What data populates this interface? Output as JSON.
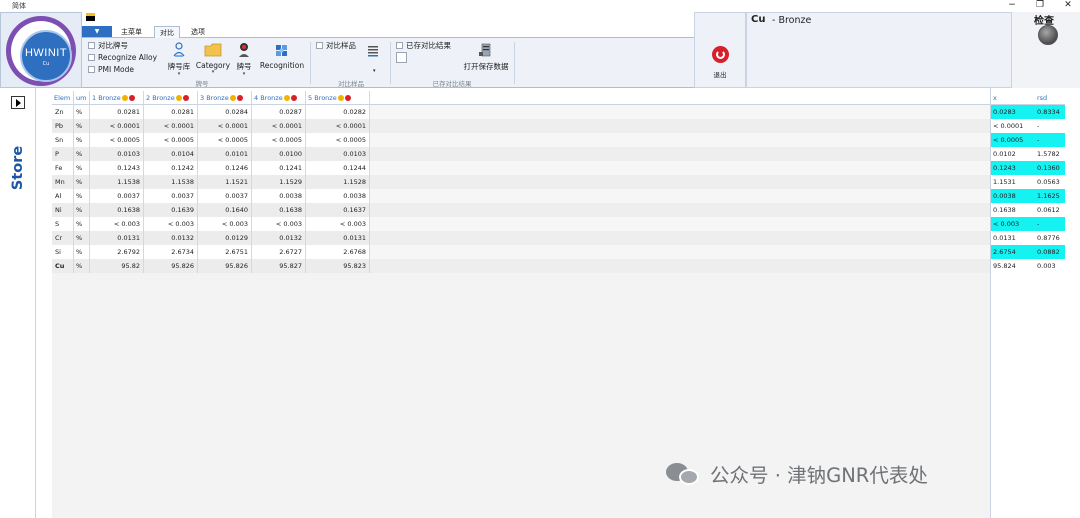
{
  "window": {
    "title": "简体",
    "min_glyph": "−",
    "restore_glyph": "❐",
    "close_glyph": "✕"
  },
  "logo": {
    "text": "HWINIT",
    "sub": "Cu"
  },
  "ribbon": {
    "tabs": [
      {
        "label": "主菜单",
        "active": false
      },
      {
        "label": "对比",
        "active": true
      },
      {
        "label": "选项",
        "active": false
      }
    ],
    "groups": {
      "grade": {
        "label": "牌号",
        "checks": [
          "对比牌号",
          "Recognize Alloy",
          "PMI Mode"
        ],
        "buttons": [
          "牌号库",
          "Category",
          "牌号",
          "Recognition"
        ]
      },
      "sample": {
        "label": "对比样品",
        "checks": [
          "对比样品"
        ]
      },
      "saved": {
        "label": "已存对比结果",
        "checks": [
          "已存对比结果"
        ],
        "open_button": "打开保存数据"
      }
    }
  },
  "exit": {
    "label": "退出"
  },
  "result": {
    "element": "Cu",
    "grade": "- Bronze"
  },
  "check": {
    "label": "检查"
  },
  "side": {
    "title": "Store Analysis"
  },
  "table": {
    "columns": [
      "Elem",
      "um",
      "1 Bronze",
      "2 Bronze",
      "3 Bronze",
      "4 Bronze",
      "5 Bronze"
    ],
    "rows": [
      {
        "el": "Zn",
        "um": "%",
        "v": [
          "0.0281",
          "0.0281",
          "0.0284",
          "0.0287",
          "0.0282"
        ]
      },
      {
        "el": "Pb",
        "um": "%",
        "v": [
          "< 0.0001",
          "< 0.0001",
          "< 0.0001",
          "< 0.0001",
          "< 0.0001"
        ]
      },
      {
        "el": "Sn",
        "um": "%",
        "v": [
          "< 0.0005",
          "< 0.0005",
          "< 0.0005",
          "< 0.0005",
          "< 0.0005"
        ]
      },
      {
        "el": "P",
        "um": "%",
        "v": [
          "0.0103",
          "0.0104",
          "0.0101",
          "0.0100",
          "0.0103"
        ]
      },
      {
        "el": "Fe",
        "um": "%",
        "v": [
          "0.1243",
          "0.1242",
          "0.1246",
          "0.1241",
          "0.1244"
        ]
      },
      {
        "el": "Mn",
        "um": "%",
        "v": [
          "1.1538",
          "1.1538",
          "1.1521",
          "1.1529",
          "1.1528"
        ]
      },
      {
        "el": "Al",
        "um": "%",
        "v": [
          "0.0037",
          "0.0037",
          "0.0037",
          "0.0038",
          "0.0038"
        ]
      },
      {
        "el": "Ni",
        "um": "%",
        "v": [
          "0.1638",
          "0.1639",
          "0.1640",
          "0.1638",
          "0.1637"
        ]
      },
      {
        "el": "S",
        "um": "%",
        "v": [
          "< 0.003",
          "< 0.003",
          "< 0.003",
          "< 0.003",
          "< 0.003"
        ]
      },
      {
        "el": "Cr",
        "um": "%",
        "v": [
          "0.0131",
          "0.0132",
          "0.0129",
          "0.0132",
          "0.0131"
        ]
      },
      {
        "el": "Si",
        "um": "%",
        "v": [
          "2.6792",
          "2.6734",
          "2.6751",
          "2.6727",
          "2.6768"
        ]
      },
      {
        "el": "Cu",
        "um": "%",
        "v": [
          "95.82",
          "95.826",
          "95.826",
          "95.827",
          "95.823"
        ]
      }
    ]
  },
  "stats": {
    "columns": [
      "x",
      "rsd"
    ],
    "rows": [
      {
        "x": "0.0283",
        "rsd": "0.8334",
        "hl": true
      },
      {
        "x": "< 0.0001",
        "rsd": "-",
        "hl": false
      },
      {
        "x": "< 0.0005",
        "rsd": "-",
        "hl": true
      },
      {
        "x": "0.0102",
        "rsd": "1.5782",
        "hl": false
      },
      {
        "x": "0.1243",
        "rsd": "0.1360",
        "hl": true
      },
      {
        "x": "1.1531",
        "rsd": "0.0563",
        "hl": false
      },
      {
        "x": "0.0038",
        "rsd": "1.1625",
        "hl": true
      },
      {
        "x": "0.1638",
        "rsd": "0.0612",
        "hl": false
      },
      {
        "x": "< 0.003",
        "rsd": "-",
        "hl": true
      },
      {
        "x": "0.0131",
        "rsd": "0.8776",
        "hl": false
      },
      {
        "x": "2.6754",
        "rsd": "0.0882",
        "hl": true
      },
      {
        "x": "95.824",
        "rsd": "0.003",
        "hl": false
      }
    ]
  },
  "watermark": {
    "text": "公众号 · 津钠GNR代表处"
  },
  "colors": {
    "accent": "#2f6fc0",
    "highlight": "#14f2f2",
    "side_title": "#1d57a4",
    "exit": "#d8202a",
    "logo_ring": "#7d4fb3"
  }
}
